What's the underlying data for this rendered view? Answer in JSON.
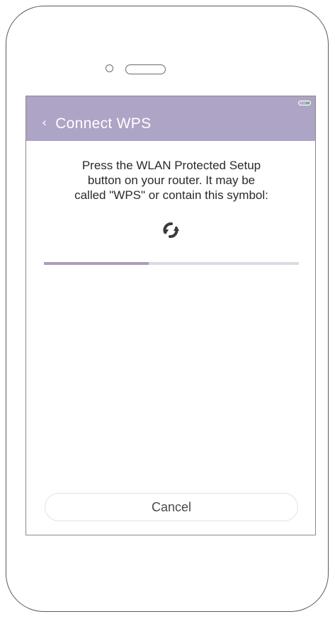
{
  "header": {
    "title": "Connect WPS",
    "back_icon": "chevron-left-icon"
  },
  "status_bar": {
    "battery_icon": "battery-icon",
    "battery_color": "#4ccb5b"
  },
  "main": {
    "instructions": "Press the WLAN Protected Setup\nbutton on your router. It may be\ncalled \"WPS\" or contain this symbol:",
    "symbol_icon": "wps-icon",
    "progress_percent": 41
  },
  "footer": {
    "cancel_label": "Cancel"
  },
  "colors": {
    "header_bg": "#aea4c5",
    "progress_fill": "#a99dbf",
    "progress_track": "#dcd9e3"
  }
}
